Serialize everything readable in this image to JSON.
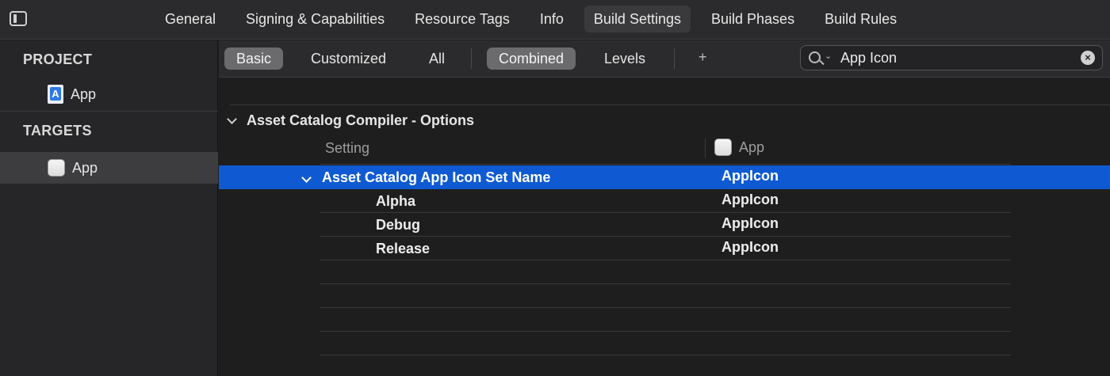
{
  "tabs": [
    {
      "label": "General"
    },
    {
      "label": "Signing & Capabilities"
    },
    {
      "label": "Resource Tags"
    },
    {
      "label": "Info"
    },
    {
      "label": "Build Settings",
      "active": true
    },
    {
      "label": "Build Phases"
    },
    {
      "label": "Build Rules"
    }
  ],
  "sidebar": {
    "project_header": "PROJECT",
    "project_item": "App",
    "targets_header": "TARGETS",
    "target_item": "App"
  },
  "filter": {
    "basic": "Basic",
    "customized": "Customized",
    "all": "All",
    "combined": "Combined",
    "levels": "Levels",
    "add": "+",
    "search_value": "App Icon"
  },
  "settings": {
    "group_title": "Asset Catalog Compiler - Options",
    "column_setting": "Setting",
    "column_target": "App",
    "selected_row": {
      "name": "Asset Catalog App Icon Set Name",
      "value": "AppIcon"
    },
    "rows": [
      {
        "name": "Alpha",
        "value": "AppIcon"
      },
      {
        "name": "Debug",
        "value": "AppIcon"
      },
      {
        "name": "Release",
        "value": "AppIcon"
      }
    ]
  },
  "colors": {
    "selection": "#0f5ad2",
    "background": "#1e1e1e",
    "sidebar": "#262628"
  }
}
